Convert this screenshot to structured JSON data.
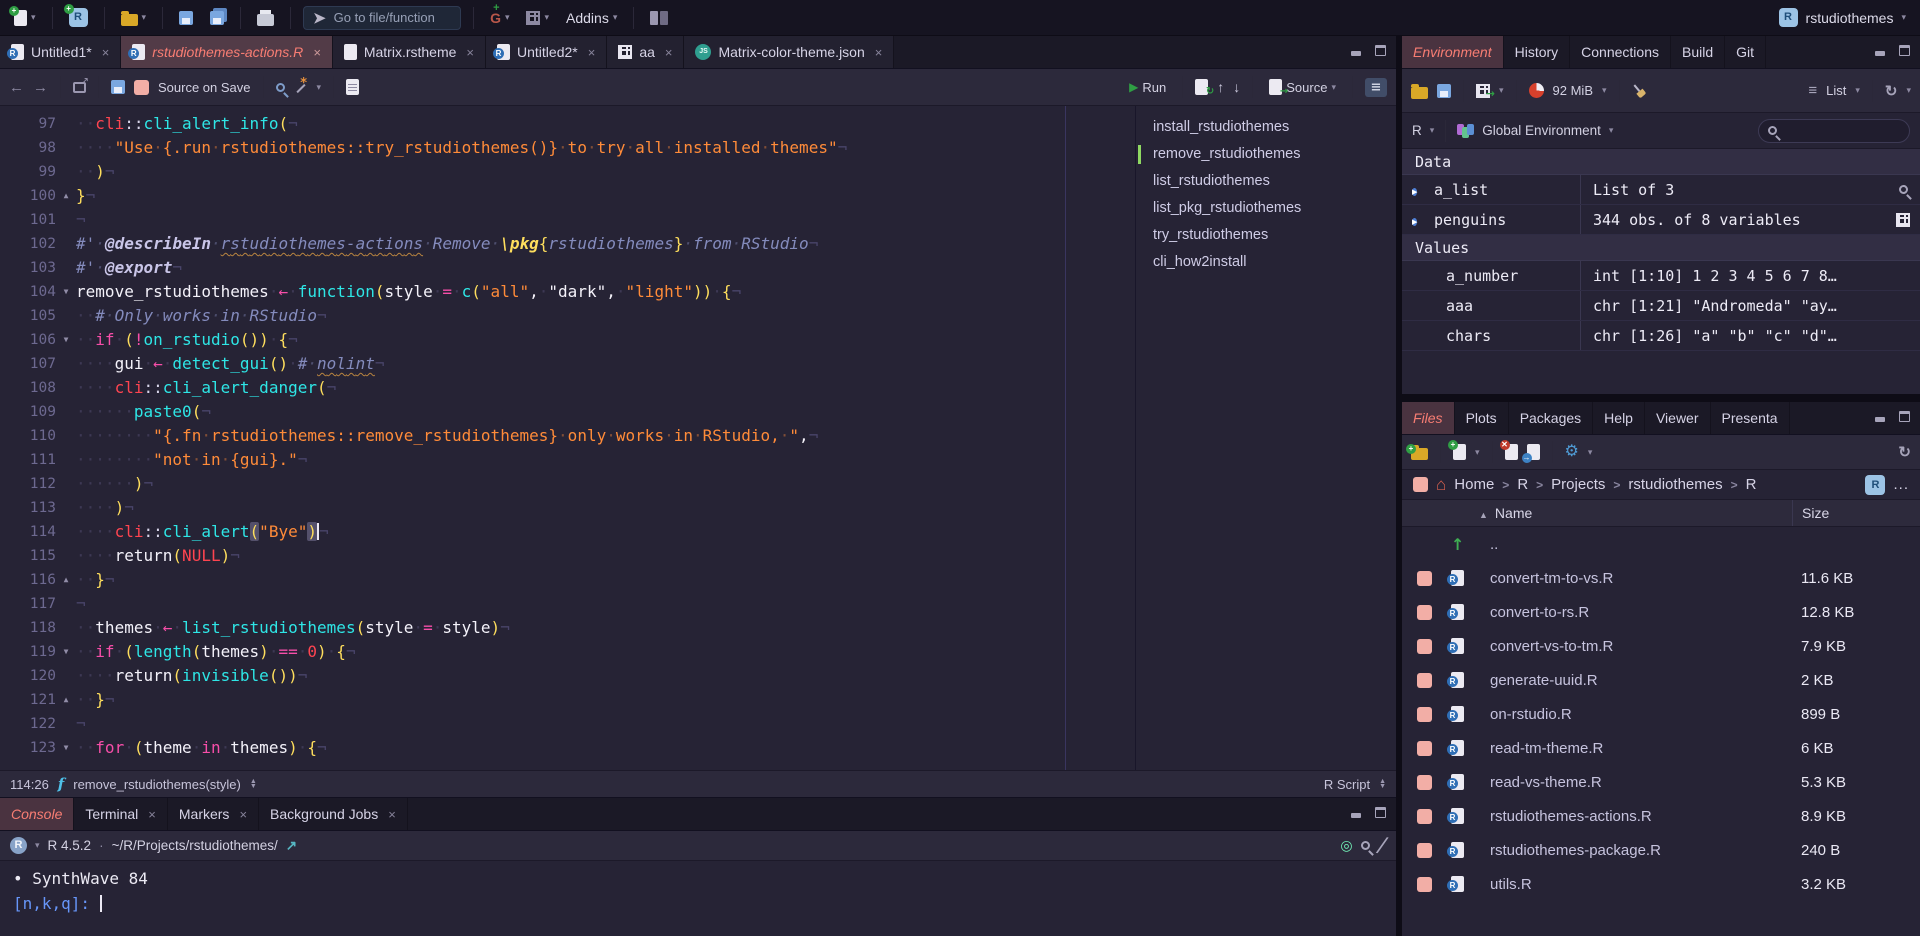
{
  "topbar": {
    "goto_placeholder": "Go to file/function",
    "addins": "Addins",
    "project": "rstudiothemes"
  },
  "editor": {
    "tabs": [
      {
        "label": "Untitled1*",
        "icon": "rdoc",
        "active": false
      },
      {
        "label": "rstudiothemes-actions.R",
        "icon": "rdoc",
        "active": true
      },
      {
        "label": "Matrix.rstheme",
        "icon": "doc",
        "active": false
      },
      {
        "label": "Untitled2*",
        "icon": "rdoc",
        "active": false
      },
      {
        "label": "aa",
        "icon": "table",
        "active": false
      },
      {
        "label": "Matrix-color-theme.json",
        "icon": "json",
        "active": false
      }
    ],
    "toolbar": {
      "source_on_save": "Source on Save",
      "run": "Run",
      "source": "Source"
    },
    "outline": [
      "install_rstudiothemes",
      "remove_rstudiothemes",
      "list_rstudiothemes",
      "list_pkg_rstudiothemes",
      "try_rstudiothemes",
      "cli_how2install"
    ],
    "outline_current": 1,
    "status": {
      "cursor": "114:26",
      "scope": "remove_rstudiothemes(style)",
      "filetype": "R Script"
    },
    "lines": [
      {
        "n": 97,
        "f": "",
        "t": [
          [
            "ws",
            "  "
          ],
          [
            "pkg",
            "cli"
          ],
          [
            "op",
            "::"
          ],
          [
            "fn",
            "cli_alert_info"
          ],
          [
            "br",
            "("
          ],
          [
            "eol",
            "¬"
          ]
        ]
      },
      {
        "n": 98,
        "f": "",
        "t": [
          [
            "ws",
            "    "
          ],
          [
            "str",
            "\"Use {.run rstudiothemes::try_rstudiothemes()} to try all installed themes\""
          ],
          [
            "eol",
            "¬"
          ]
        ]
      },
      {
        "n": 99,
        "f": "",
        "t": [
          [
            "ws",
            "  "
          ],
          [
            "br",
            ")"
          ],
          [
            "eol",
            "¬"
          ]
        ]
      },
      {
        "n": 100,
        "f": "^",
        "t": [
          [
            "br",
            "}"
          ],
          [
            "eol",
            "¬"
          ]
        ]
      },
      {
        "n": 101,
        "f": "",
        "t": [
          [
            "eol",
            "¬"
          ]
        ]
      },
      {
        "n": 102,
        "f": "",
        "t": [
          [
            "cmt",
            "#' "
          ],
          [
            "tag",
            "@describeIn"
          ],
          [
            "cmt",
            " "
          ],
          [
            "cmtu",
            "rstudiothemes-actions"
          ],
          [
            "cmt",
            " Remove "
          ],
          [
            "tagy",
            "\\pkg"
          ],
          [
            "br",
            "{"
          ],
          [
            "cmt",
            "rstudiothemes"
          ],
          [
            "br",
            "}"
          ],
          [
            "cmt",
            " from RStudio"
          ],
          [
            "eol",
            "¬"
          ]
        ]
      },
      {
        "n": 103,
        "f": "",
        "t": [
          [
            "cmt",
            "#' "
          ],
          [
            "tag",
            "@export"
          ],
          [
            "eol",
            "¬"
          ]
        ]
      },
      {
        "n": 104,
        "f": "v",
        "t": [
          [
            "id",
            "remove_rstudiothemes"
          ],
          [
            "ws",
            " "
          ],
          [
            "kw",
            "←"
          ],
          [
            "ws",
            " "
          ],
          [
            "fn",
            "function"
          ],
          [
            "br",
            "("
          ],
          [
            "id",
            "style"
          ],
          [
            "ws",
            " "
          ],
          [
            "kw",
            "="
          ],
          [
            "ws",
            " "
          ],
          [
            "fn",
            "c"
          ],
          [
            "br",
            "("
          ],
          [
            "str",
            "\"all\""
          ],
          [
            "id",
            ","
          ],
          [
            "ws",
            " "
          ],
          [
            "strw",
            "\"dark\""
          ],
          [
            "id",
            ","
          ],
          [
            "ws",
            " "
          ],
          [
            "str",
            "\"light\""
          ],
          [
            "br",
            "))"
          ],
          [
            "ws",
            " "
          ],
          [
            "br",
            "{"
          ],
          [
            "eol",
            "¬"
          ]
        ]
      },
      {
        "n": 105,
        "f": "",
        "t": [
          [
            "ws",
            "  "
          ],
          [
            "cmt",
            "# Only works in RStudio"
          ],
          [
            "eol",
            "¬"
          ]
        ]
      },
      {
        "n": 106,
        "f": "v",
        "t": [
          [
            "ws",
            "  "
          ],
          [
            "kw",
            "if"
          ],
          [
            "ws",
            " "
          ],
          [
            "br",
            "("
          ],
          [
            "kw",
            "!"
          ],
          [
            "fn",
            "on_rstudio"
          ],
          [
            "br",
            "())"
          ],
          [
            "ws",
            " "
          ],
          [
            "br",
            "{"
          ],
          [
            "eol",
            "¬"
          ]
        ]
      },
      {
        "n": 107,
        "f": "",
        "t": [
          [
            "ws",
            "    "
          ],
          [
            "id",
            "gui"
          ],
          [
            "ws",
            " "
          ],
          [
            "kw",
            "←"
          ],
          [
            "ws",
            " "
          ],
          [
            "fn",
            "detect_gui"
          ],
          [
            "br",
            "()"
          ],
          [
            "ws",
            " "
          ],
          [
            "cmt",
            "# "
          ],
          [
            "cmtu",
            "nolint"
          ],
          [
            "eol",
            "¬"
          ]
        ]
      },
      {
        "n": 108,
        "f": "",
        "t": [
          [
            "ws",
            "    "
          ],
          [
            "pkg",
            "cli"
          ],
          [
            "op",
            "::"
          ],
          [
            "fn",
            "cli_alert_danger"
          ],
          [
            "br",
            "("
          ],
          [
            "eol",
            "¬"
          ]
        ]
      },
      {
        "n": 109,
        "f": "",
        "t": [
          [
            "ws",
            "      "
          ],
          [
            "fn",
            "paste0"
          ],
          [
            "br",
            "("
          ],
          [
            "eol",
            "¬"
          ]
        ]
      },
      {
        "n": 110,
        "f": "",
        "t": [
          [
            "ws",
            "        "
          ],
          [
            "str",
            "\"{.fn rstudiothemes::remove_rstudiothemes} only works in RStudio, \""
          ],
          [
            "id",
            ","
          ],
          [
            "eol",
            "¬"
          ]
        ]
      },
      {
        "n": 111,
        "f": "",
        "t": [
          [
            "ws",
            "        "
          ],
          [
            "str",
            "\"not in {gui}.\""
          ],
          [
            "eol",
            "¬"
          ]
        ]
      },
      {
        "n": 112,
        "f": "",
        "t": [
          [
            "ws",
            "      "
          ],
          [
            "br",
            ")"
          ],
          [
            "eol",
            "¬"
          ]
        ]
      },
      {
        "n": 113,
        "f": "",
        "t": [
          [
            "ws",
            "    "
          ],
          [
            "br",
            ")"
          ],
          [
            "eol",
            "¬"
          ]
        ]
      },
      {
        "n": 114,
        "f": "",
        "t": [
          [
            "ws",
            "    "
          ],
          [
            "pkg",
            "cli"
          ],
          [
            "op",
            "::"
          ],
          [
            "fn",
            "cli_alert"
          ],
          [
            "brh",
            "("
          ],
          [
            "str",
            "\"Bye\""
          ],
          [
            "brh",
            ")"
          ],
          [
            "cur",
            ""
          ],
          [
            "eol",
            "¬"
          ]
        ]
      },
      {
        "n": 115,
        "f": "",
        "t": [
          [
            "ws",
            "    "
          ],
          [
            "id",
            "return"
          ],
          [
            "br",
            "("
          ],
          [
            "nul",
            "NULL"
          ],
          [
            "br",
            ")"
          ],
          [
            "eol",
            "¬"
          ]
        ]
      },
      {
        "n": 116,
        "f": "^",
        "t": [
          [
            "ws",
            "  "
          ],
          [
            "br",
            "}"
          ],
          [
            "eol",
            "¬"
          ]
        ]
      },
      {
        "n": 117,
        "f": "",
        "t": [
          [
            "eol",
            "¬"
          ]
        ]
      },
      {
        "n": 118,
        "f": "",
        "t": [
          [
            "ws",
            "  "
          ],
          [
            "id",
            "themes"
          ],
          [
            "ws",
            " "
          ],
          [
            "kw",
            "←"
          ],
          [
            "ws",
            " "
          ],
          [
            "fn",
            "list_rstudiothemes"
          ],
          [
            "br",
            "("
          ],
          [
            "id",
            "style"
          ],
          [
            "ws",
            " "
          ],
          [
            "kw",
            "="
          ],
          [
            "ws",
            " "
          ],
          [
            "id",
            "style"
          ],
          [
            "br",
            ")"
          ],
          [
            "eol",
            "¬"
          ]
        ]
      },
      {
        "n": 119,
        "f": "v",
        "t": [
          [
            "ws",
            "  "
          ],
          [
            "kw",
            "if"
          ],
          [
            "ws",
            " "
          ],
          [
            "br",
            "("
          ],
          [
            "fn",
            "length"
          ],
          [
            "br",
            "("
          ],
          [
            "id",
            "themes"
          ],
          [
            "br",
            ")"
          ],
          [
            "ws",
            " "
          ],
          [
            "kw",
            "=="
          ],
          [
            "ws",
            " "
          ],
          [
            "num",
            "0"
          ],
          [
            "br",
            ")"
          ],
          [
            "ws",
            " "
          ],
          [
            "br",
            "{"
          ],
          [
            "eol",
            "¬"
          ]
        ]
      },
      {
        "n": 120,
        "f": "",
        "t": [
          [
            "ws",
            "    "
          ],
          [
            "id",
            "return"
          ],
          [
            "br",
            "("
          ],
          [
            "fn",
            "invisible"
          ],
          [
            "br",
            "())"
          ],
          [
            "eol",
            "¬"
          ]
        ]
      },
      {
        "n": 121,
        "f": "^",
        "t": [
          [
            "ws",
            "  "
          ],
          [
            "br",
            "}"
          ],
          [
            "eol",
            "¬"
          ]
        ]
      },
      {
        "n": 122,
        "f": "",
        "t": [
          [
            "eol",
            "¬"
          ]
        ]
      },
      {
        "n": 123,
        "f": "v",
        "t": [
          [
            "ws",
            "  "
          ],
          [
            "kw",
            "for"
          ],
          [
            "ws",
            " "
          ],
          [
            "br",
            "("
          ],
          [
            "id",
            "theme"
          ],
          [
            "ws",
            " "
          ],
          [
            "kw",
            "in"
          ],
          [
            "ws",
            " "
          ],
          [
            "id",
            "themes"
          ],
          [
            "br",
            ")"
          ],
          [
            "ws",
            " "
          ],
          [
            "br",
            "{"
          ],
          [
            "eol",
            "¬"
          ]
        ]
      }
    ]
  },
  "console": {
    "tabs": [
      {
        "label": "Console",
        "active": true,
        "closable": false
      },
      {
        "label": "Terminal",
        "active": false,
        "closable": true
      },
      {
        "label": "Markers",
        "active": false,
        "closable": true
      },
      {
        "label": "Background Jobs",
        "active": false,
        "closable": true
      }
    ],
    "info": {
      "version": "R 4.5.2",
      "sep": "·",
      "path": "~/R/Projects/rstudiothemes/"
    },
    "lines": [
      {
        "cls": "out",
        "text": "• SynthWave 84",
        "cursor": false
      },
      {
        "cls": "prompt",
        "text": "[n,k,q]: ",
        "cursor": true
      }
    ]
  },
  "environment": {
    "tabs": [
      "Environment",
      "History",
      "Connections",
      "Build",
      "Git"
    ],
    "toolbar": {
      "memory": "92 MiB",
      "list": "List"
    },
    "scope": {
      "lang": "R",
      "name": "Global Environment"
    },
    "sections": [
      {
        "title": "Data",
        "rows": [
          {
            "name": "a_list",
            "value": "List of 3",
            "expand": true,
            "icon": "magnifier"
          },
          {
            "name": "penguins",
            "value": "344 obs. of 8 variables",
            "expand": true,
            "icon": "table"
          }
        ]
      },
      {
        "title": "Values",
        "rows": [
          {
            "name": "a_number",
            "value": "int [1:10] 1 2 3 4 5 6 7 8…",
            "expand": false,
            "icon": ""
          },
          {
            "name": "aaa",
            "value": "chr [1:21] \"Andromeda\" \"ay…",
            "expand": false,
            "icon": ""
          },
          {
            "name": "chars",
            "value": "chr [1:26] \"a\" \"b\" \"c\" \"d\"…",
            "expand": false,
            "icon": ""
          }
        ]
      }
    ]
  },
  "files": {
    "tabs": [
      "Files",
      "Plots",
      "Packages",
      "Help",
      "Viewer",
      "Presenta"
    ],
    "breadcrumb": [
      "Home",
      "R",
      "Projects",
      "rstudiothemes",
      "R"
    ],
    "more": "...",
    "header": {
      "name": "Name",
      "size": "Size"
    },
    "rows": [
      {
        "icon": "up",
        "name": "..",
        "size": ""
      },
      {
        "icon": "rdoc",
        "name": "convert-tm-to-vs.R",
        "size": "11.6 KB"
      },
      {
        "icon": "rdoc",
        "name": "convert-to-rs.R",
        "size": "12.8 KB"
      },
      {
        "icon": "rdoc",
        "name": "convert-vs-to-tm.R",
        "size": "7.9 KB"
      },
      {
        "icon": "rdoc",
        "name": "generate-uuid.R",
        "size": "2 KB"
      },
      {
        "icon": "rdoc",
        "name": "on-rstudio.R",
        "size": "899 B"
      },
      {
        "icon": "rdoc",
        "name": "read-tm-theme.R",
        "size": "6 KB"
      },
      {
        "icon": "rdoc",
        "name": "read-vs-theme.R",
        "size": "5.3 KB"
      },
      {
        "icon": "rdoc",
        "name": "rstudiothemes-actions.R",
        "size": "8.9 KB"
      },
      {
        "icon": "rdoc",
        "name": "rstudiothemes-package.R",
        "size": "240 B"
      },
      {
        "icon": "rdoc",
        "name": "utils.R",
        "size": "3.2 KB"
      }
    ]
  }
}
